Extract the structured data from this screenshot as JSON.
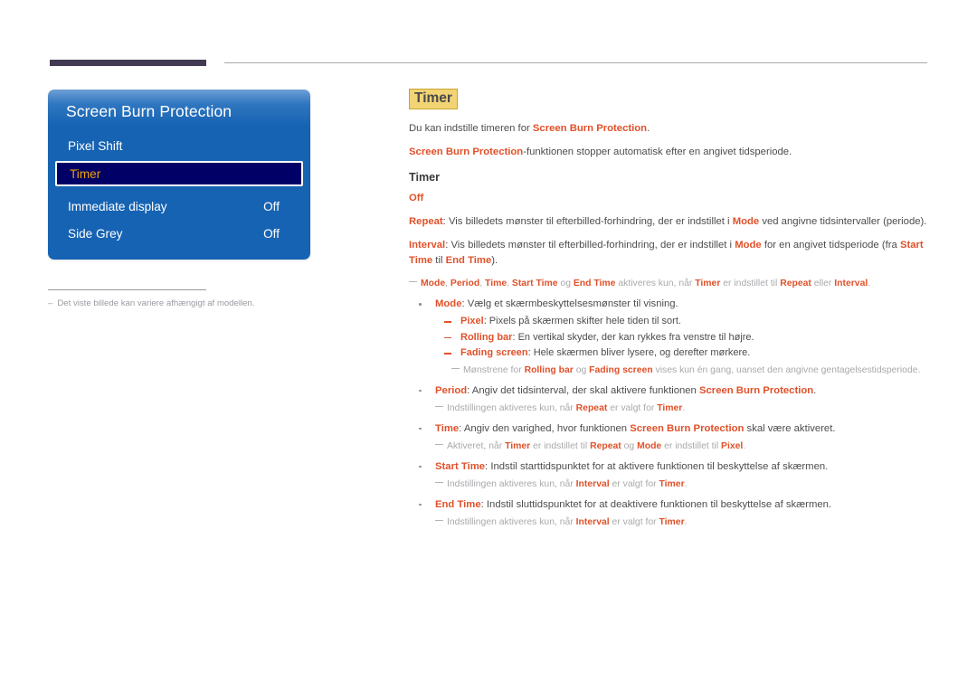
{
  "colors": {
    "accent": "#e0512a",
    "muted": "#a9a9ad",
    "osd_blue": "#1663b3",
    "osd_selected_bg": "#000066",
    "osd_selected_text": "#f0a000",
    "title_highlight": "#f2d474",
    "top_rule": "#423a52"
  },
  "osd": {
    "title": "Screen Burn Protection",
    "rows": [
      {
        "label": "Pixel Shift",
        "value": "",
        "selected": false
      },
      {
        "label": "Timer",
        "value": "",
        "selected": true
      },
      {
        "label": "Immediate display",
        "value": "Off",
        "selected": false
      },
      {
        "label": "Side Grey",
        "value": "Off",
        "selected": false
      }
    ]
  },
  "footnote": {
    "dash": "–",
    "text": "Det viste billede kan variere afhængigt af modellen."
  },
  "content": {
    "page_title": "Timer",
    "intro": {
      "p1_a": "Du kan indstille timeren for ",
      "p1_b": "Screen Burn Protection",
      "p1_c": ".",
      "p2_a": "Screen Burn Protection",
      "p2_b": "-funktionen stopper automatisk efter en angivet tidsperiode."
    },
    "section_title": "Timer",
    "options": {
      "off": "Off",
      "repeat_label": "Repeat",
      "repeat_a": ": Vis billedets mønster til efterbilled-forhindring, der er indstillet i ",
      "repeat_mode": "Mode",
      "repeat_b": " ved angivne tidsintervaller (periode).",
      "interval_label": "Interval",
      "interval_a": ": Vis billedets mønster til efterbilled-forhindring, der er indstillet i ",
      "interval_mode": "Mode",
      "interval_b": " for en angivet tidsperiode (fra ",
      "interval_start": "Start Time",
      "interval_c": " til ",
      "interval_end": "End Time",
      "interval_d": ")."
    },
    "top_note": {
      "t1": "Mode",
      "s1": ", ",
      "t2": "Period",
      "s2": ", ",
      "t3": "Time",
      "s3": ", ",
      "t4": "Start Time",
      "s4": " og ",
      "t5": "End Time",
      "s5": " aktiveres kun, når ",
      "t6": "Timer",
      "s6": " er indstillet til ",
      "t7": "Repeat",
      "s7": " eller ",
      "t8": "Interval",
      "s8": "."
    },
    "bullets": {
      "mode": {
        "label": "Mode",
        "text": ": Vælg et skærmbeskyttelsesmønster til visning.",
        "sub": [
          {
            "label": "Pixel",
            "text": ": Pixels på skærmen skifter hele tiden til sort."
          },
          {
            "label": "Rolling bar",
            "text": ": En vertikal skyder, der kan rykkes fra venstre til højre."
          },
          {
            "label": "Fading screen",
            "text": ": Hele skærmen bliver lysere, og derefter mørkere."
          }
        ],
        "sub_note": {
          "a": "Mønstrene for ",
          "b": "Rolling bar",
          "c": " og ",
          "d": "Fading screen",
          "e": " vises kun én gang, uanset den angivne gentagelsestidsperiode."
        }
      },
      "period": {
        "label": "Period",
        "text_a": ": Angiv det tidsinterval, der skal aktivere funktionen ",
        "text_b": "Screen Burn Protection",
        "text_c": ".",
        "note": {
          "a": "Indstillingen aktiveres kun, når ",
          "b": "Repeat",
          "c": " er valgt for ",
          "d": "Timer",
          "e": "."
        }
      },
      "time": {
        "label": "Time",
        "text_a": ": Angiv den varighed, hvor funktionen ",
        "text_b": "Screen Burn Protection",
        "text_c": " skal være aktiveret.",
        "note": {
          "a": "Aktiveret, når ",
          "b": "Timer",
          "c": " er indstillet til ",
          "d": "Repeat",
          "e": " og ",
          "f": "Mode",
          "g": " er indstillet til ",
          "h": "Pixel",
          "i": "."
        }
      },
      "start_time": {
        "label": "Start Time",
        "text": ": Indstil starttidspunktet for at aktivere funktionen til beskyttelse af skærmen.",
        "note": {
          "a": "Indstillingen aktiveres kun, når ",
          "b": "Interval",
          "c": " er valgt for ",
          "d": "Timer",
          "e": "."
        }
      },
      "end_time": {
        "label": "End Time",
        "text": ": Indstil sluttidspunktet for at deaktivere funktionen til beskyttelse af skærmen.",
        "note": {
          "a": "Indstillingen aktiveres kun, når ",
          "b": "Interval",
          "c": " er valgt for ",
          "d": "Timer",
          "e": "."
        }
      }
    }
  }
}
